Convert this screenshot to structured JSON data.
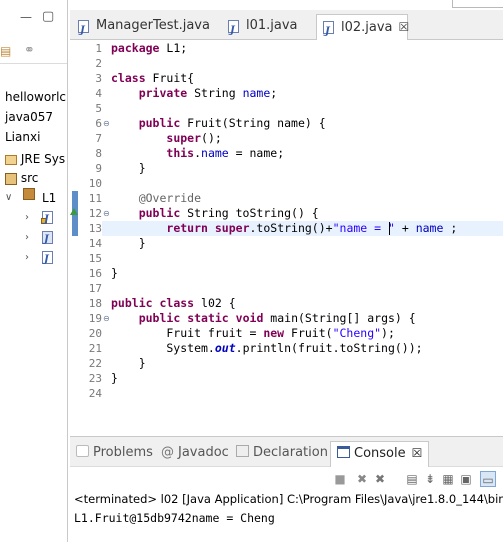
{
  "package_explorer": {
    "items": [
      {
        "label": "helloworlc"
      },
      {
        "label": "java057"
      },
      {
        "label": "Lianxi"
      },
      {
        "label": "JRE Sys"
      },
      {
        "label": "src"
      },
      {
        "label": "L1"
      }
    ]
  },
  "editor": {
    "tabs": [
      {
        "label": "ManagerTest.java",
        "active": false
      },
      {
        "label": "l01.java",
        "active": false
      },
      {
        "label": "l02.java",
        "active": true,
        "close": "☒"
      }
    ],
    "line_numbers": [
      "1",
      "2",
      "3",
      "4",
      "5",
      "6",
      "7",
      "8",
      "9",
      "10",
      "11",
      "12",
      "13",
      "14",
      "15",
      "16",
      "17",
      "18",
      "19",
      "20",
      "21",
      "22",
      "23",
      "24"
    ],
    "code": [
      "package L1;",
      "",
      "class Fruit{",
      "    private String name;",
      "",
      "    public Fruit(String name) {",
      "        super();",
      "        this.name = name;",
      "    }",
      "",
      "    @Override",
      "    public String toString() {",
      "        return super.toString()+\"name = \" + name ;",
      "    }",
      "",
      "}",
      "",
      "public class l02 {",
      "    public static void main(String[] args) {",
      "        Fruit fruit = new Fruit(\"Cheng\");",
      "        System.out.println(fruit.toString());",
      "    }",
      "}",
      ""
    ],
    "highlighted_line": 13
  },
  "console": {
    "tabs": [
      {
        "label": "Problems",
        "icon": "problems-icon"
      },
      {
        "label": "Javadoc",
        "icon": "at-icon"
      },
      {
        "label": "Declaration",
        "icon": "declaration-icon"
      },
      {
        "label": "Console",
        "icon": "console-icon",
        "active": true,
        "close": "☒"
      }
    ],
    "status": "<terminated> l02 [Java Application] C:\\Program Files\\Java\\jre1.8.0_144\\bin",
    "output": "L1.Fruit@15db9742name = Cheng"
  },
  "colors": {
    "keyword": "#7f0055",
    "field": "#0000c0",
    "string": "#2a00ff",
    "annotation": "#646464",
    "line_highlight": "#e8f2fe"
  }
}
